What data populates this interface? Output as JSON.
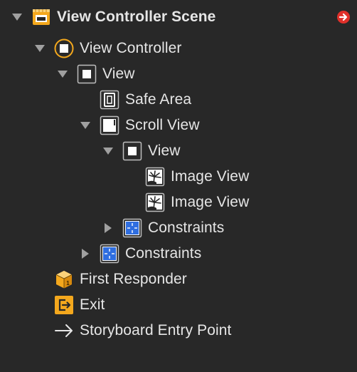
{
  "outline": {
    "scene": {
      "label": "View Controller Scene",
      "icon": "storyboard-scene-icon",
      "expanded": true,
      "badge": "red-arrow-badge-icon"
    },
    "view_controller": {
      "label": "View Controller",
      "icon": "view-controller-icon",
      "expanded": true
    },
    "view": {
      "label": "View",
      "icon": "view-icon",
      "expanded": true
    },
    "safe_area": {
      "label": "Safe Area",
      "icon": "safe-area-icon"
    },
    "scroll_view": {
      "label": "Scroll View",
      "icon": "scroll-view-icon",
      "expanded": true
    },
    "content_view": {
      "label": "View",
      "icon": "view-icon",
      "expanded": true
    },
    "image_view_1": {
      "label": "Image View",
      "icon": "image-view-icon"
    },
    "image_view_2": {
      "label": "Image View",
      "icon": "image-view-icon"
    },
    "constraints_inner": {
      "label": "Constraints",
      "icon": "constraints-icon",
      "expanded": false
    },
    "constraints_outer": {
      "label": "Constraints",
      "icon": "constraints-icon",
      "expanded": false
    },
    "first_responder": {
      "label": "First Responder",
      "icon": "first-responder-cube-icon"
    },
    "exit": {
      "label": "Exit",
      "icon": "exit-icon"
    },
    "entry_point": {
      "label": "Storyboard Entry Point",
      "icon": "arrow-right-icon"
    }
  },
  "colors": {
    "background": "#282828",
    "text": "#e6e6e6",
    "disclosure": "#a0a0a0",
    "accent_orange": "#f4a81d",
    "constraints_blue": "#2f6ee0",
    "badge_red": "#e0302a"
  }
}
